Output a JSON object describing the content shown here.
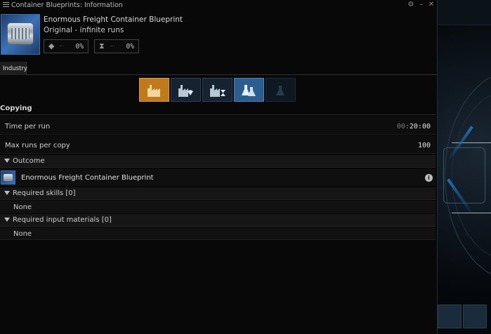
{
  "window": {
    "title": "Container Blueprints: Information",
    "controls": [
      "⚙",
      "–",
      "✕"
    ]
  },
  "blueprint": {
    "name": "Enormous Freight Container Blueprint",
    "subtitle": "Original - infinite runs",
    "material_efficiency": "0%",
    "time_efficiency": "0%"
  },
  "tabs": [
    {
      "label": "Industry",
      "active": true
    }
  ],
  "activities": [
    {
      "icon": "manufacturing-icon",
      "state": "selected"
    },
    {
      "icon": "copy-icon",
      "state": "normal"
    },
    {
      "icon": "time-efficiency-icon",
      "state": "normal"
    },
    {
      "icon": "research-icon",
      "state": "active"
    },
    {
      "icon": "invention-icon",
      "state": "disabled"
    }
  ],
  "activity_section": "Copying",
  "rows": {
    "time_per_run": {
      "label": "Time per run",
      "value_dim": "00:",
      "value": "20:00"
    },
    "max_runs": {
      "label": "Max runs per copy",
      "value": "100"
    }
  },
  "outcome": {
    "label": "Outcome",
    "item": "Enormous Freight Container Blueprint"
  },
  "required_skills": {
    "label": "Required skills [0]",
    "value": "None"
  },
  "required_materials": {
    "label": "Required input materials [0]",
    "value": "None"
  },
  "colors": {
    "accent_orange": "#c07a1a",
    "accent_blue": "#2b5e8f",
    "icon_frame": "#3a6cae"
  }
}
